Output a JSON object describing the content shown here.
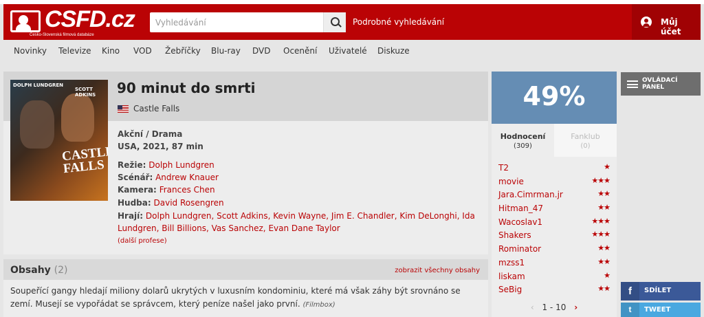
{
  "header": {
    "logo_text": "CSFD.cz",
    "logo_subtitle": "Česko-Slovenská filmová databáze",
    "search_placeholder": "Vyhledávání",
    "advanced_search": "Podrobné vyhledávání",
    "account": "Můj účet"
  },
  "nav": [
    "Novinky",
    "Televize",
    "Kino",
    "VOD",
    "Žebříčky",
    "Blu-ray",
    "DVD",
    "Ocenění",
    "Uživatelé",
    "Diskuze"
  ],
  "movie": {
    "poster_names_left": "DOLPH LUNDGREN",
    "poster_names_right": "SCOTT ADKINS",
    "poster_title": "CASTLE FALLS",
    "title": "90 minut do smrti",
    "original_title": "Castle Falls",
    "genre": "Akční / Drama",
    "origin": "USA, 2021, 87 min",
    "directing_label": "Režie:",
    "directing": "Dolph Lundgren",
    "screenplay_label": "Scénář:",
    "screenplay": "Andrew Knauer",
    "camera_label": "Kamera:",
    "camera": "Frances Chen",
    "music_label": "Hudba:",
    "music": "David Rosengren",
    "cast_label": "Hrají:",
    "cast": "Dolph Lundgren, Scott Adkins, Kevin Wayne, Jim E. Chandler, Kim DeLonghi, Ida Lundgren, Bill Billions, Vas Sanchez, Evan Dane Taylor",
    "more_professions": "(další profese)"
  },
  "plots": {
    "title": "Obsahy",
    "count": "(2)",
    "show_all": "zobrazit všechny obsahy",
    "text": "Soupeřící gangy hledají miliony dolarů ukrytých v luxusním kondominiu, které má však záhy být srovnáno se zemí. Musejí se vypořádat se správcem, který peníze našel jako první.",
    "source": "(Filmbox)"
  },
  "rating": {
    "value": "49%",
    "accent_color": "#658db4",
    "tab_ratings": "Hodnocení",
    "tab_ratings_count": "(309)",
    "tab_fanclub": "Fanklub",
    "tab_fanclub_count": "(0)",
    "users": [
      {
        "name": "T2",
        "stars": "★"
      },
      {
        "name": "movie",
        "stars": "★★★"
      },
      {
        "name": "Jara.Cimrman.jr",
        "stars": "★★"
      },
      {
        "name": "Hitman_47",
        "stars": "★★"
      },
      {
        "name": "Wacoslav1",
        "stars": "★★★"
      },
      {
        "name": "Shakers",
        "stars": "★★★"
      },
      {
        "name": "Rominator",
        "stars": "★★"
      },
      {
        "name": "mzss1",
        "stars": "★★"
      },
      {
        "name": "liskam",
        "stars": "★"
      },
      {
        "name": "SeBig",
        "stars": "★★"
      }
    ],
    "pager": "1 - 10",
    "pager_prev": "‹",
    "pager_next": "›"
  },
  "sidebar": {
    "panel_label": "OVLÁDACÍ PANEL",
    "share_facebook": "SDÍLET",
    "share_twitter": "TWEET"
  },
  "colors": {
    "brand": "#ba0305",
    "rating": "#658db4"
  }
}
